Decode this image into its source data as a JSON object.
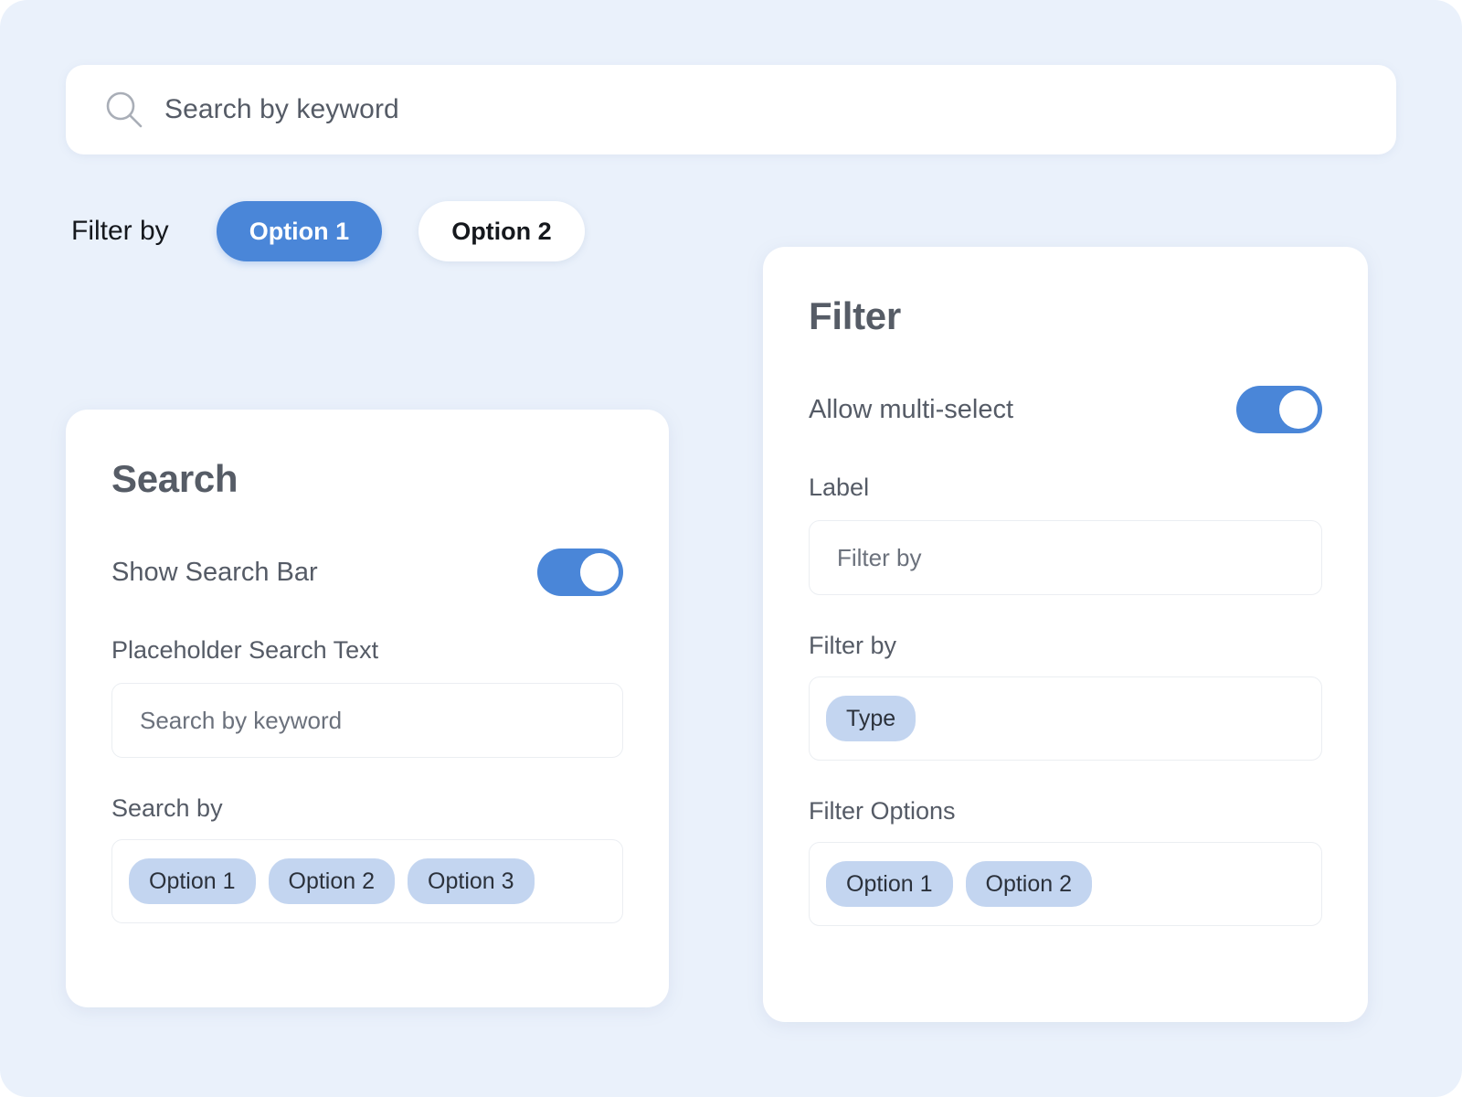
{
  "preview": {
    "search_bar": {
      "icon": "search-icon",
      "placeholder": "Search by keyword"
    },
    "filter_by_label": "Filter by",
    "filter_buttons": [
      {
        "label": "Option 1",
        "state": "active"
      },
      {
        "label": "Option 2",
        "state": "inactive"
      }
    ]
  },
  "search_panel": {
    "title": "Search",
    "show_search_bar": {
      "label": "Show Search Bar",
      "value": "on"
    },
    "placeholder_field": {
      "label": "Placeholder Search Text",
      "value": "Search by keyword"
    },
    "search_by": {
      "label": "Search by",
      "chips": [
        "Option 1",
        "Option 2",
        "Option 3"
      ]
    }
  },
  "filter_panel": {
    "title": "Filter",
    "allow_multi_select": {
      "label": "Allow multi-select",
      "value": "on"
    },
    "label_field": {
      "label": "Label",
      "value": "Filter by"
    },
    "filter_by": {
      "label": "Filter by",
      "chips": [
        "Type"
      ]
    },
    "filter_options": {
      "label": "Filter Options",
      "chips": [
        "Option 1",
        "Option 2"
      ]
    }
  },
  "colors": {
    "page_background": "#eaf1fb",
    "accent_blue": "#4a86d8",
    "chip_blue": "#c3d5f0",
    "card_white": "#ffffff",
    "heading_gray": "#565c66",
    "body_gray": "#555b66",
    "border_gray": "#ebeef2"
  }
}
